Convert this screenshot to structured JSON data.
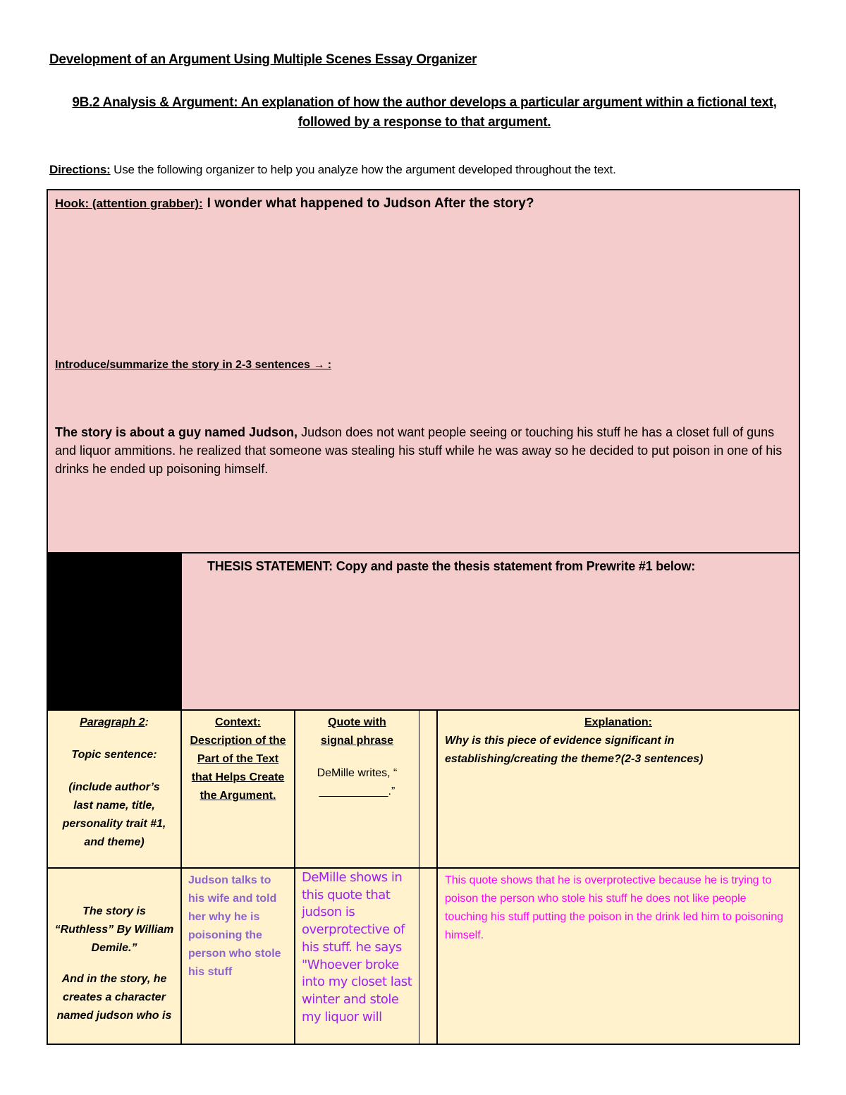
{
  "document": {
    "title": "Development of an Argument Using Multiple Scenes Essay Organizer",
    "subtitle": "9B.2 Analysis & Argument: An explanation of how the author develops a particular argument within a fictional text, followed by a response to that argument.",
    "directions_label": "Directions:",
    "directions_text": " Use the following organizer to help you analyze how the argument developed throughout the text."
  },
  "hook_section": {
    "hook_label": "Hook: (attention grabber):",
    "hook_value": "I wonder what happened to Judson After the story?",
    "intro_label": "Introduce/summarize the story in 2-3 sentences → :",
    "summary_lead": "The story is about a guy named Judson,",
    "summary_text": " Judson does not want people seeing or touching his stuff he has a closet full of guns and liquor ammitions. he realized that someone was stealing his stuff while he was away so he decided to put poison in one of his drinks he ended up poisoning himself."
  },
  "thesis_section": {
    "label": "THESIS STATEMENT:  Copy and paste the thesis statement from Prewrite #1 below:"
  },
  "table": {
    "header": {
      "paragraph": {
        "title": "Paragraph 2",
        "title_suffix": ":",
        "topic": "Topic sentence:",
        "instructions": "(include author’s last name, title, personality trait #1, and theme)"
      },
      "context": "Context: Description of the Part of the Text that Helps Create the Argument. ",
      "quote": {
        "title": "Quote with signal phrase",
        "template_1": "DeMille writes, “",
        "template_2": "___________.”"
      },
      "explanation": {
        "title": "Explanation:",
        "prompt": "Why is this piece of evidence significant in establishing/creating the theme?(2-3 sentences)"
      }
    },
    "row": {
      "topic_1": "The story is “Ruthless” By William Demile.”",
      "topic_2": "And in the story, he creates a character named judson who is",
      "context": "Judson talks to his wife and told her why he is poisoning the person who stole his stuff",
      "quote": "DeMille shows in this quote that judson is overprotective of his stuff. he says \"Whoever broke into my closet last winter and stole my liquor will",
      "explanation": " This quote shows that he is overprotective because he is trying to poison the person who stole his stuff he does not like people touching his stuff putting the poison in the drink led him to poisoning himself."
    }
  },
  "colors": {
    "pink_fill": "#f4cccc",
    "cream_fill": "#fff2cc",
    "context_text": "#8e63ce",
    "quote_text": "#a020f0",
    "explanation_text": "#ff00ff"
  }
}
